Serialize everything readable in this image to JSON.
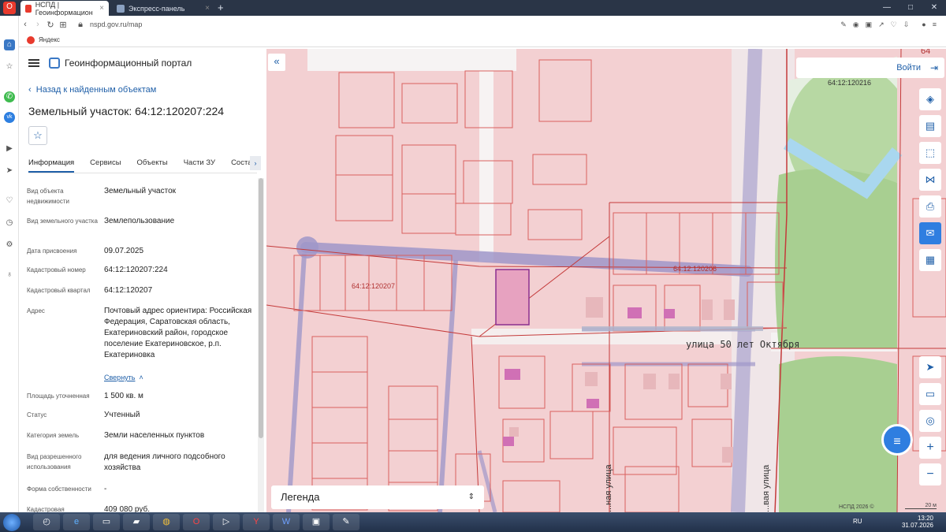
{
  "browser": {
    "tabs": [
      {
        "label": "НСПД | Геоинформацион",
        "active": true
      },
      {
        "label": "Экспресс-панель",
        "active": false
      }
    ],
    "url": "nspd.gov.ru/map",
    "bookmark": "Яндекс"
  },
  "app": {
    "title": "Геоинформационный портал",
    "back_label": "Назад к найденным объектам",
    "object_title": "Земельный участок: 64:12:120207:224",
    "tabs": [
      "Информация",
      "Сервисы",
      "Объекты",
      "Части ЗУ",
      "Состав"
    ]
  },
  "props": [
    {
      "k": "Вид объекта недвижимости",
      "v": "Земельный участок"
    },
    {
      "k": "Вид земельного участка",
      "v": "Землепользование"
    },
    {
      "k": "Дата присвоения",
      "v": "09.07.2025"
    },
    {
      "k": "Кадастровый номер",
      "v": "64:12:120207:224"
    },
    {
      "k": "Кадастровый квартал",
      "v": "64:12:120207"
    },
    {
      "k": "Адрес",
      "v": "Почтовый адрес ориентира: Российская Федерация, Саратовская область, Екатериновский район, городское поселение Екатериновское, р.п. Екатериновка"
    },
    {
      "k": "Площадь уточненная",
      "v": "1 500 кв. м"
    },
    {
      "k": "Статус",
      "v": "Учтенный"
    },
    {
      "k": "Категория земель",
      "v": "Земли населенных пунктов"
    },
    {
      "k": "Вид разрешенного использования",
      "v": "для ведения личного подсобного хозяйства"
    },
    {
      "k": "Форма собственности",
      "v": "-"
    },
    {
      "k": "Кадастровая",
      "v": "409 080 руб."
    }
  ],
  "collapse_label": "Свернуть",
  "map": {
    "login_label": "Войти",
    "legend_label": "Легенда",
    "street_h": "улица 50 лет Октября",
    "street_v1": "...ная улица",
    "street_v2": "...вая улица",
    "label_120207": "64:12:120207",
    "label_120206": "64:12:120206",
    "label_120216": "64:12:120216",
    "label_64": "64",
    "attribution": "НСПД 2026 ©",
    "scale": "20 м"
  },
  "taskbar": {
    "lang": "RU",
    "time": "13:20",
    "date": "31.07.2026"
  }
}
